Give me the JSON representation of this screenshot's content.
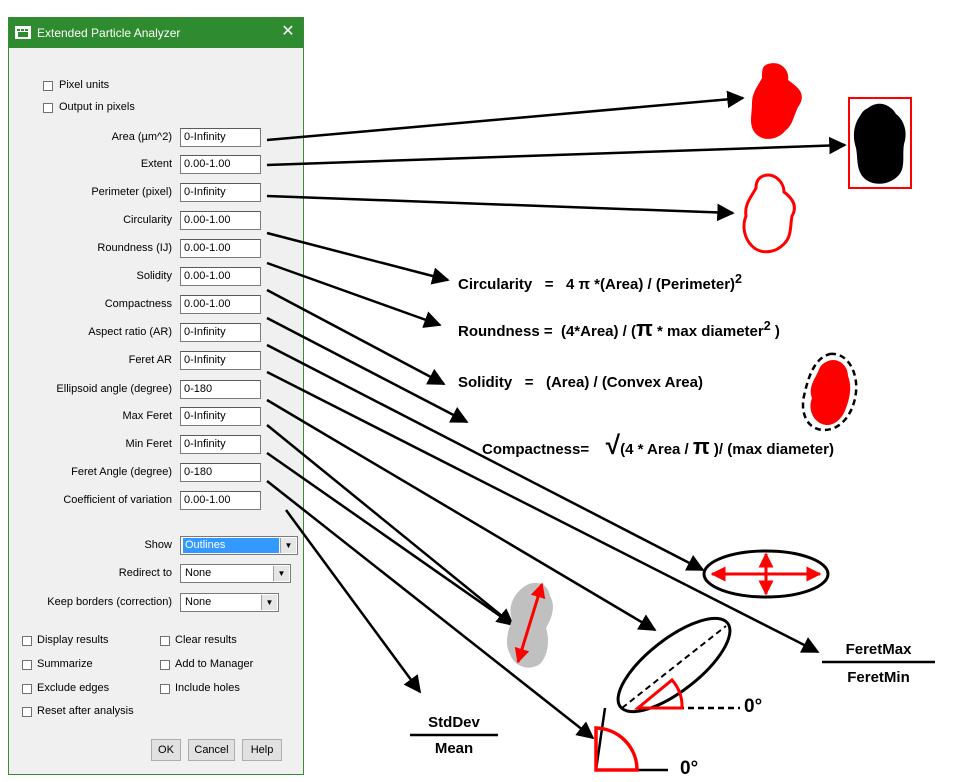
{
  "window": {
    "title": "Extended Particle Analyzer",
    "close_icon": "close-icon"
  },
  "checkboxes_top": [
    {
      "label": "Pixel units",
      "checked": false
    },
    {
      "label": "Output in pixels",
      "checked": false
    }
  ],
  "fields": [
    {
      "label": "Area (µm^2)",
      "value": "0-Infinity"
    },
    {
      "label": "Extent",
      "value": "0.00-1.00"
    },
    {
      "label": "Perimeter (pixel)",
      "value": "0-Infinity"
    },
    {
      "label": "Circularity",
      "value": "0.00-1.00"
    },
    {
      "label": "Roundness (IJ)",
      "value": "0.00-1.00"
    },
    {
      "label": "Solidity",
      "value": "0.00-1.00"
    },
    {
      "label": "Compactness",
      "value": "0.00-1.00"
    },
    {
      "label": "Aspect ratio (AR)",
      "value": "0-Infinity"
    },
    {
      "label": "Feret AR",
      "value": "0-Infinity"
    },
    {
      "label": "Ellipsoid angle (degree)",
      "value": "0-180"
    },
    {
      "label": "Max Feret",
      "value": "0-Infinity"
    },
    {
      "label": "Min Feret",
      "value": "0-Infinity"
    },
    {
      "label": "Feret Angle (degree)",
      "value": "0-180"
    },
    {
      "label": "Coefficient of variation",
      "value": "0.00-1.00"
    }
  ],
  "selects": [
    {
      "label": "Show",
      "value": "Outlines",
      "highlighted": true
    },
    {
      "label": "Redirect to",
      "value": "None",
      "highlighted": false
    },
    {
      "label": "Keep borders (correction)",
      "value": "None",
      "highlighted": false
    }
  ],
  "options": [
    {
      "label": "Display results",
      "checked": false
    },
    {
      "label": "Clear results",
      "checked": false
    },
    {
      "label": "Summarize",
      "checked": false
    },
    {
      "label": "Add to Manager",
      "checked": false
    },
    {
      "label": "Exclude edges",
      "checked": false
    },
    {
      "label": "Include holes",
      "checked": false
    },
    {
      "label": "Reset after analysis",
      "checked": false
    }
  ],
  "buttons": {
    "ok": "OK",
    "cancel": "Cancel",
    "help": "Help"
  },
  "annotations": {
    "circularity": {
      "lead": "Circularity",
      "eq": "=",
      "rhs": "4 π *(Area) / (Perimeter)",
      "sup": "2"
    },
    "roundness": {
      "lead": "Roundness",
      "eq": "=",
      "rhs_a": "(4*Area) / (",
      "pi": "π",
      "rhs_b": " * max diameter",
      "sup": "2",
      "rhs_c": " )"
    },
    "solidity": {
      "lead": "Solidity",
      "eq": "=",
      "rhs": "(Area) / (Convex Area)"
    },
    "compactness": {
      "lead": "Compactness=",
      "root": "√",
      "rhs_a": "(4 * Area / ",
      "pi": "π",
      "rhs_b": " )/ (max diameter)"
    },
    "feret_ratio": {
      "num": "FeretMax",
      "den": "FeretMin"
    },
    "cv_ratio": {
      "num": "StdDev",
      "den": "Mean"
    },
    "angle_label_1": "0°",
    "angle_label_2": "0°"
  },
  "colors": {
    "title_bar": "#2e8b2f",
    "accent_red": "#ff0000",
    "highlight": "#3399ff"
  }
}
